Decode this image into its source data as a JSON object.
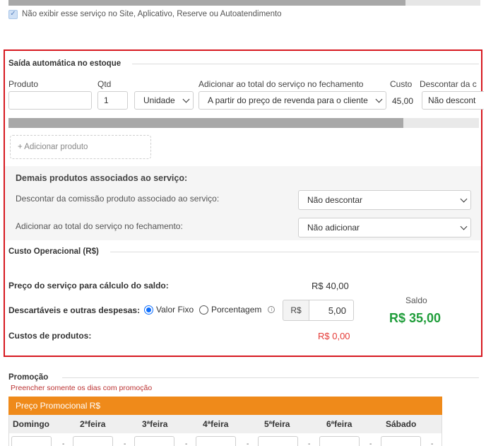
{
  "visibility": {
    "hide_service_label": "Não exibir esse serviço no Site, Aplicativo, Reserve ou Autoatendimento",
    "hide_service_checked": true
  },
  "stock": {
    "title": "Saída automática no estoque",
    "columns": {
      "product": "Produto",
      "qty": "Qtd",
      "add_total": "Adicionar ao total do serviço no fechamento",
      "cost": "Custo",
      "discount": "Descontar da c"
    },
    "row": {
      "product_value": "",
      "qty_value": "1",
      "unit_value": "Unidade",
      "add_total_value": "A partir do preço de revenda para o cliente",
      "cost_value": "45,00",
      "discount_value": "Não descont"
    },
    "add_product_label": "+ Adicionar produto"
  },
  "associated": {
    "title": "Demais produtos associados ao serviço:",
    "commission_label": "Descontar da comissão produto associado ao serviço:",
    "commission_value": "Não descontar",
    "add_total_label": "Adicionar ao total do serviço no fechamento:",
    "add_total_value": "Não adicionar"
  },
  "operational": {
    "title": "Custo Operacional (R$)",
    "price_label": "Preço do serviço para cálculo do saldo:",
    "price_value": "R$ 40,00",
    "disposables_label": "Descartáveis e outras despesas:",
    "option_fixed": "Valor Fixo",
    "option_percent": "Porcentagem",
    "selected_option": "fixed",
    "currency_prefix": "R$",
    "disposables_value": "5,00",
    "products_cost_label": "Custos de produtos:",
    "products_cost_value": "R$ 0,00",
    "balance_label": "Saldo",
    "balance_value": "R$ 35,00"
  },
  "promotion": {
    "title": "Promoção",
    "note": "Preencher somente os dias com promoção",
    "table_title": "Preço Promocional R$",
    "days": [
      "Domingo",
      "2ªfeira",
      "3ªfeira",
      "4ªfeira",
      "5ªfeira",
      "6ªfeira",
      "Sábado"
    ]
  },
  "colors": {
    "highlight_border": "#d71920",
    "balance_green": "#1f9d3a",
    "cost_red": "#e53935",
    "promo_orange": "#ef8a1a",
    "radio_blue": "#0d6efd"
  },
  "icons": [
    "checkmark-icon",
    "chevron-down-icon",
    "info-icon"
  ]
}
